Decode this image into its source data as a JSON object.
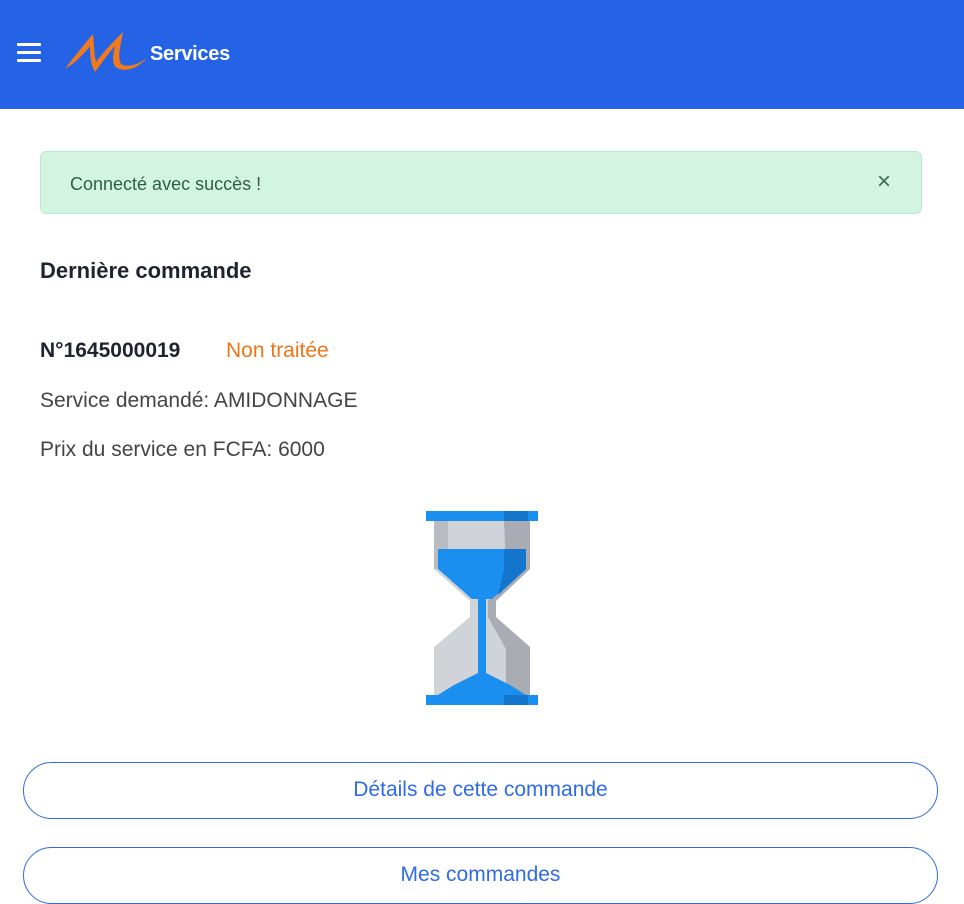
{
  "header": {
    "brand": "Services",
    "background": "#2563e6",
    "logo_color": "#f07a1c",
    "menu_icon": "hamburger-icon"
  },
  "alert": {
    "message": "Connecté avec succès !",
    "close": "×",
    "background": "#d4f4e2"
  },
  "order": {
    "section_title": "Dernière commande",
    "number": "N°1645000019",
    "status": "Non traitée",
    "status_color": "#f07516",
    "service": "Service demandé: AMIDONNAGE",
    "price": "Prix du service en FCFA: 6000",
    "status_icon": "hourglass-icon"
  },
  "actions": {
    "details_label": "Détails de cette commande",
    "orders_label": "Mes commandes",
    "accent": "#2f6be9"
  }
}
